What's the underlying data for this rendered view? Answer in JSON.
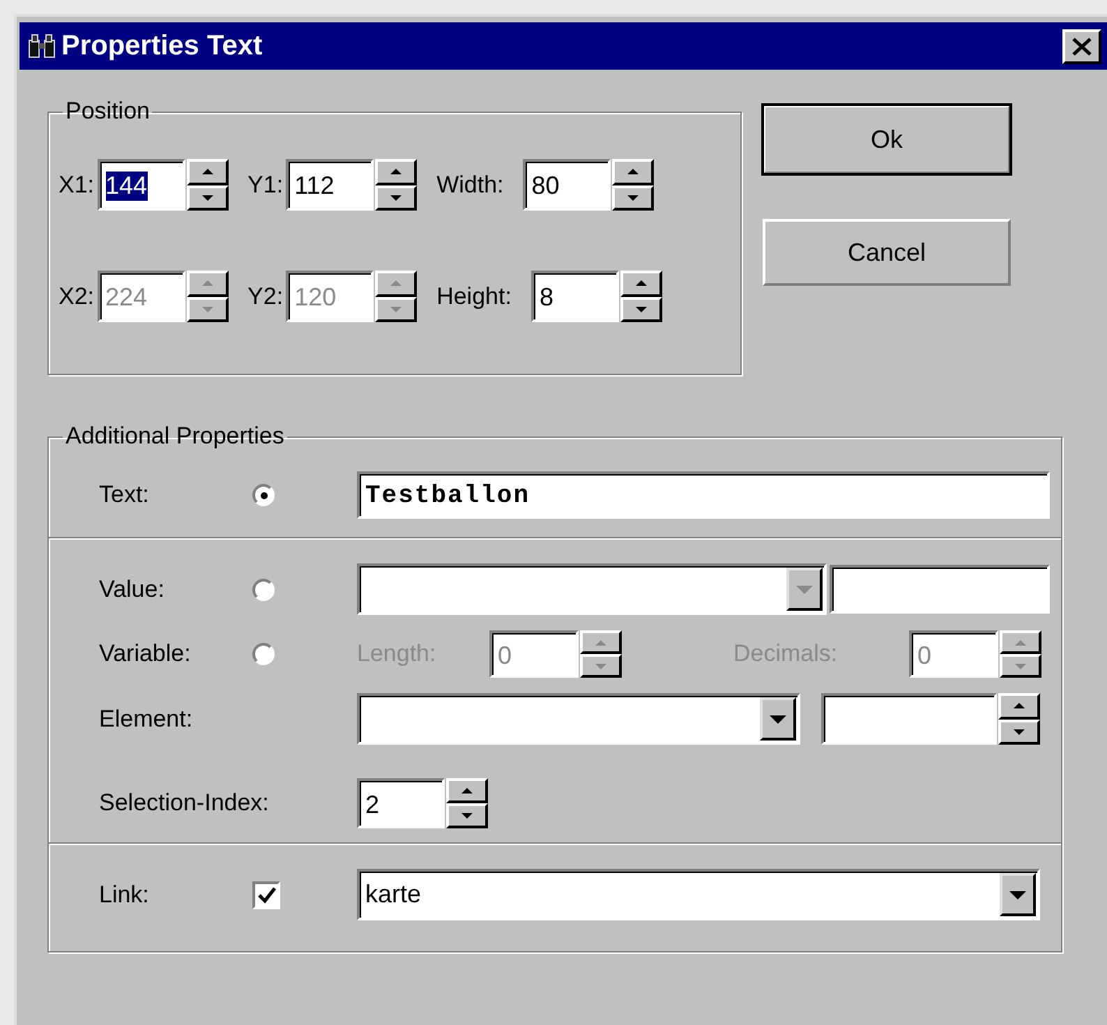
{
  "window": {
    "title": "Properties Text"
  },
  "position": {
    "title": "Position",
    "fields": [
      {
        "label": "X1:",
        "value": "144",
        "disabled": false,
        "selected": true
      },
      {
        "label": "Y1:",
        "value": "112",
        "disabled": false,
        "selected": false
      },
      {
        "label": "Width:",
        "value": "80",
        "disabled": false,
        "selected": false
      },
      {
        "label": "X2:",
        "value": "224",
        "disabled": true,
        "selected": false
      },
      {
        "label": "Y2:",
        "value": "120",
        "disabled": true,
        "selected": false
      },
      {
        "label": "Height:",
        "value": "8",
        "disabled": false,
        "selected": false
      }
    ]
  },
  "buttons": [
    {
      "label": "Ok",
      "default": true
    },
    {
      "label": "Cancel",
      "default": false
    }
  ],
  "additional": {
    "title": "Additional Properties",
    "text_row": {
      "label": "Text:",
      "selected": true,
      "value": "Testballon"
    },
    "value_row": {
      "label": "Value:",
      "selected": false,
      "arrow_disabled": true
    },
    "variable_row": {
      "label": "Variable:",
      "selected": false,
      "length": {
        "label": "Length:",
        "value": "0",
        "disabled": true
      },
      "decimals": {
        "label": "Decimals:",
        "value": "0",
        "disabled": true
      }
    },
    "element_row": {
      "label": "Element:",
      "arrow_disabled": false
    },
    "selection_index": {
      "label": "Selection-Index:",
      "value": "2"
    },
    "link": {
      "label": "Link:",
      "checked": true,
      "value": "karte"
    }
  }
}
